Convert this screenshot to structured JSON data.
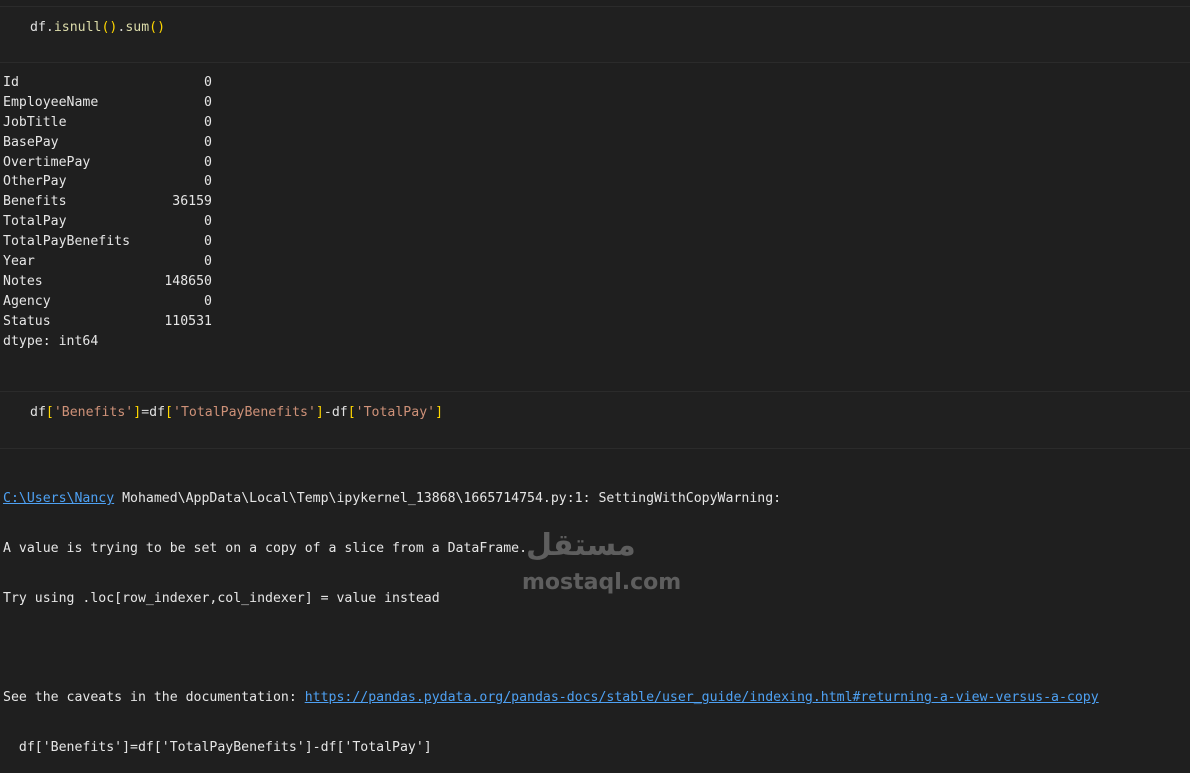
{
  "cell1": {
    "code": {
      "var": "df",
      "dot1": ".",
      "fn1": "isnull",
      "paren1": "()",
      "dot2": ".",
      "fn2": "sum",
      "paren2": "()"
    }
  },
  "output": {
    "rows": [
      {
        "name": "Id",
        "value": "0"
      },
      {
        "name": "EmployeeName",
        "value": "0"
      },
      {
        "name": "JobTitle",
        "value": "0"
      },
      {
        "name": "BasePay",
        "value": "0"
      },
      {
        "name": "OvertimePay",
        "value": "0"
      },
      {
        "name": "OtherPay",
        "value": "0"
      },
      {
        "name": "Benefits",
        "value": "36159"
      },
      {
        "name": "TotalPay",
        "value": "0"
      },
      {
        "name": "TotalPayBenefits",
        "value": "0"
      },
      {
        "name": "Year",
        "value": "0"
      },
      {
        "name": "Notes",
        "value": "148650"
      },
      {
        "name": "Agency",
        "value": "0"
      },
      {
        "name": "Status",
        "value": "110531"
      }
    ],
    "dtype": "dtype: int64"
  },
  "cell2": {
    "code": {
      "var1": "df",
      "b1o": "[",
      "s1": "'Benefits'",
      "b1c": "]",
      "eq": "=",
      "var2": "df",
      "b2o": "[",
      "s2": "'TotalPayBenefits'",
      "b2c": "]",
      "minus": "-",
      "var3": "df",
      "b3o": "[",
      "s3": "'TotalPay'",
      "b3c": "]"
    }
  },
  "warning": {
    "path_link": "C:\\Users\\Nancy",
    "path_rest": " Mohamed\\AppData\\Local\\Temp\\ipykernel_13868\\1665714754.py:1: SettingWithCopyWarning:",
    "line2": "A value is trying to be set on a copy of a slice from a DataFrame.",
    "line3": "Try using .loc[row_indexer,col_indexer] = value instead",
    "line5_prefix": "See the caveats in the documentation: ",
    "doc_link": "https://pandas.pydata.org/pandas-docs/stable/user_guide/indexing.html#returning-a-view-versus-a-copy",
    "line6": "  df['Benefits']=df['TotalPayBenefits']-df['TotalPay']"
  },
  "watermark": {
    "logo": "مستقل",
    "text": "mostaql.com"
  },
  "colors": {
    "background": "#1f1f1f",
    "cell_bg": "#202020",
    "link": "#4ea1f3",
    "string": "#ce9178",
    "function": "#dcdcaa",
    "bracket": "#ffd700"
  }
}
